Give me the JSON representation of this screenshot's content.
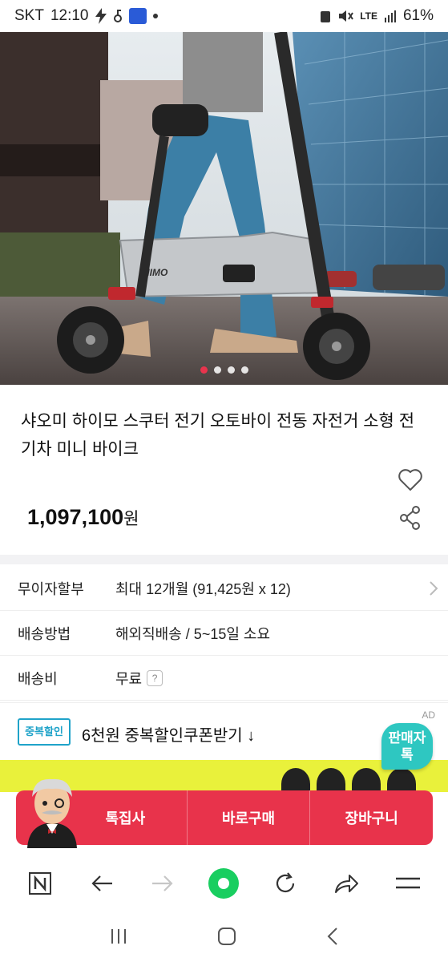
{
  "status_bar": {
    "carrier": "SKT",
    "time": "12:10",
    "network": "LTE",
    "battery": "61%"
  },
  "hero": {
    "brand_text": "HIMO",
    "slide_count": 4,
    "active_slide": 1
  },
  "product": {
    "title": "샤오미 하이모 스쿠터 전기 오토바이 전동 자전거 소형 전기차 미니 바이크",
    "price": "1,097,100",
    "currency": "원"
  },
  "info_rows": [
    {
      "label": "무이자할부",
      "value": "최대 12개월 (91,425원 x 12)"
    },
    {
      "label": "배송방법",
      "value": "해외직배송 / 5~15일 소요"
    },
    {
      "label": "배송비",
      "value": "무료",
      "badge": "?"
    }
  ],
  "coupon": {
    "badge": "중복할인",
    "text": "6천원 중복할인쿠폰받기 ↓",
    "ad_label": "AD"
  },
  "seller_chat": {
    "label": "판매자 톡"
  },
  "actions": {
    "store": "톡집사",
    "buy_now": "바로구매",
    "cart": "장바구니"
  },
  "browser_bar": {
    "icons": [
      "naver-icon",
      "back-icon",
      "forward-icon",
      "home-icon",
      "refresh-icon",
      "share-icon",
      "menu-icon"
    ]
  },
  "colors": {
    "accent_red": "#e8334b",
    "teal": "#2ec7c1",
    "coupon_blue": "#1fa3c9",
    "strip_yellow": "#e9f13b"
  }
}
